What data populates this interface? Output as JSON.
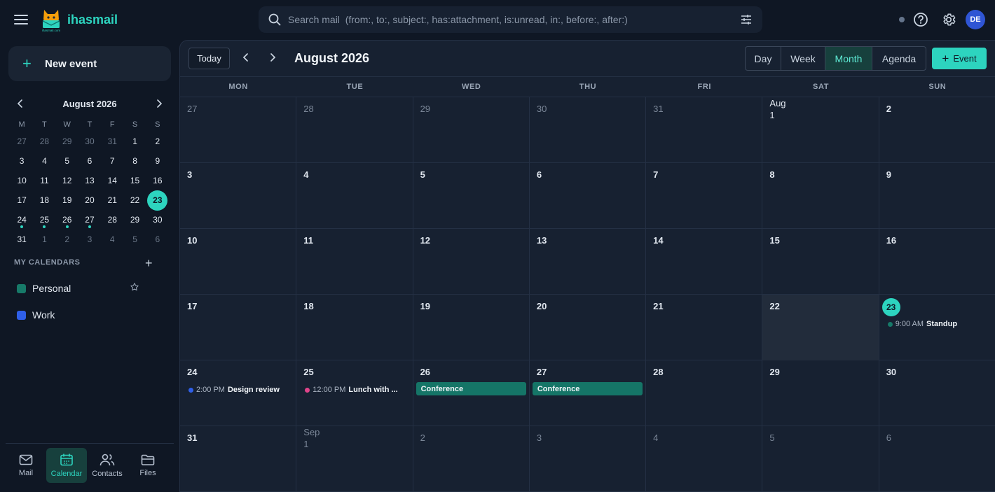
{
  "app": {
    "name": "ihasmail",
    "logo_caption": "ihasmail.com"
  },
  "search": {
    "placeholder": "Search mail  (from:, to:, subject:, has:attachment, is:unread, in:, before:, after:)"
  },
  "user": {
    "initials": "DE"
  },
  "colors": {
    "accent": "#2dd4bf",
    "personal": "#177a69",
    "work": "#2f5fe8",
    "pink": "#e0448a",
    "avatar": "#2f55d4"
  },
  "sidebar": {
    "new_event_label": "New event",
    "mini": {
      "title": "August 2026",
      "dow": [
        "M",
        "T",
        "W",
        "T",
        "F",
        "S",
        "S"
      ],
      "weeks": [
        [
          {
            "d": "27",
            "dim": true
          },
          {
            "d": "28",
            "dim": true
          },
          {
            "d": "29",
            "dim": true
          },
          {
            "d": "30",
            "dim": true
          },
          {
            "d": "31",
            "dim": true
          },
          {
            "d": "1"
          },
          {
            "d": "2"
          }
        ],
        [
          {
            "d": "3"
          },
          {
            "d": "4"
          },
          {
            "d": "5"
          },
          {
            "d": "6"
          },
          {
            "d": "7"
          },
          {
            "d": "8"
          },
          {
            "d": "9"
          }
        ],
        [
          {
            "d": "10"
          },
          {
            "d": "11"
          },
          {
            "d": "12"
          },
          {
            "d": "13"
          },
          {
            "d": "14"
          },
          {
            "d": "15"
          },
          {
            "d": "16"
          }
        ],
        [
          {
            "d": "17"
          },
          {
            "d": "18"
          },
          {
            "d": "19"
          },
          {
            "d": "20"
          },
          {
            "d": "21"
          },
          {
            "d": "22"
          },
          {
            "d": "23",
            "today": true
          }
        ],
        [
          {
            "d": "24",
            "dot": true
          },
          {
            "d": "25",
            "dot": true
          },
          {
            "d": "26",
            "dot": true
          },
          {
            "d": "27",
            "dot": true
          },
          {
            "d": "28"
          },
          {
            "d": "29"
          },
          {
            "d": "30"
          }
        ],
        [
          {
            "d": "31"
          },
          {
            "d": "1",
            "dim": true
          },
          {
            "d": "2",
            "dim": true
          },
          {
            "d": "3",
            "dim": true
          },
          {
            "d": "4",
            "dim": true
          },
          {
            "d": "5",
            "dim": true
          },
          {
            "d": "6",
            "dim": true
          }
        ]
      ]
    },
    "calendars_heading": "MY CALENDARS",
    "calendars": [
      {
        "name": "Personal",
        "color": "#177a69"
      },
      {
        "name": "Work",
        "color": "#2f5fe8"
      }
    ],
    "nav": [
      {
        "label": "Mail",
        "icon": "mail-icon"
      },
      {
        "label": "Calendar",
        "icon": "calendar-icon",
        "active": true
      },
      {
        "label": "Contacts",
        "icon": "contacts-icon"
      },
      {
        "label": "Files",
        "icon": "folder-icon"
      }
    ]
  },
  "calendar": {
    "today_label": "Today",
    "title": "August 2026",
    "views": [
      "Day",
      "Week",
      "Month",
      "Agenda"
    ],
    "active_view": "Month",
    "add_label": "Event",
    "dow": [
      "MON",
      "TUE",
      "WED",
      "THU",
      "FRI",
      "SAT",
      "SUN"
    ],
    "weeks": [
      [
        {
          "n": "27",
          "dim": true
        },
        {
          "n": "28",
          "dim": true
        },
        {
          "n": "29",
          "dim": true
        },
        {
          "n": "30",
          "dim": true
        },
        {
          "n": "31",
          "dim": true
        },
        {
          "n": "Aug\n1",
          "two": true,
          "bright": true
        },
        {
          "n": "2"
        }
      ],
      [
        {
          "n": "3"
        },
        {
          "n": "4"
        },
        {
          "n": "5"
        },
        {
          "n": "6"
        },
        {
          "n": "7"
        },
        {
          "n": "8"
        },
        {
          "n": "9"
        }
      ],
      [
        {
          "n": "10"
        },
        {
          "n": "11"
        },
        {
          "n": "12"
        },
        {
          "n": "13"
        },
        {
          "n": "14"
        },
        {
          "n": "15"
        },
        {
          "n": "16"
        }
      ],
      [
        {
          "n": "17"
        },
        {
          "n": "18"
        },
        {
          "n": "19"
        },
        {
          "n": "20"
        },
        {
          "n": "21"
        },
        {
          "n": "22",
          "shade": true
        },
        {
          "n": "23",
          "today": true,
          "events": [
            {
              "time": "9:00 AM",
              "title": "Standup",
              "color": "#177a69"
            }
          ]
        }
      ],
      [
        {
          "n": "24",
          "events": [
            {
              "time": "2:00 PM",
              "title": "Design review",
              "color": "#2f5fe8"
            }
          ]
        },
        {
          "n": "25",
          "events": [
            {
              "time": "12:00 PM",
              "title": "Lunch with ...",
              "color": "#e0448a"
            }
          ]
        },
        {
          "n": "26",
          "bar": "Conference"
        },
        {
          "n": "27",
          "bar": "Conference"
        },
        {
          "n": "28"
        },
        {
          "n": "29"
        },
        {
          "n": "30"
        }
      ],
      [
        {
          "n": "31"
        },
        {
          "n": "Sep\n1",
          "two": true,
          "dim": true
        },
        {
          "n": "2",
          "dim": true
        },
        {
          "n": "3",
          "dim": true
        },
        {
          "n": "4",
          "dim": true
        },
        {
          "n": "5",
          "dim": true
        },
        {
          "n": "6",
          "dim": true
        }
      ]
    ]
  }
}
